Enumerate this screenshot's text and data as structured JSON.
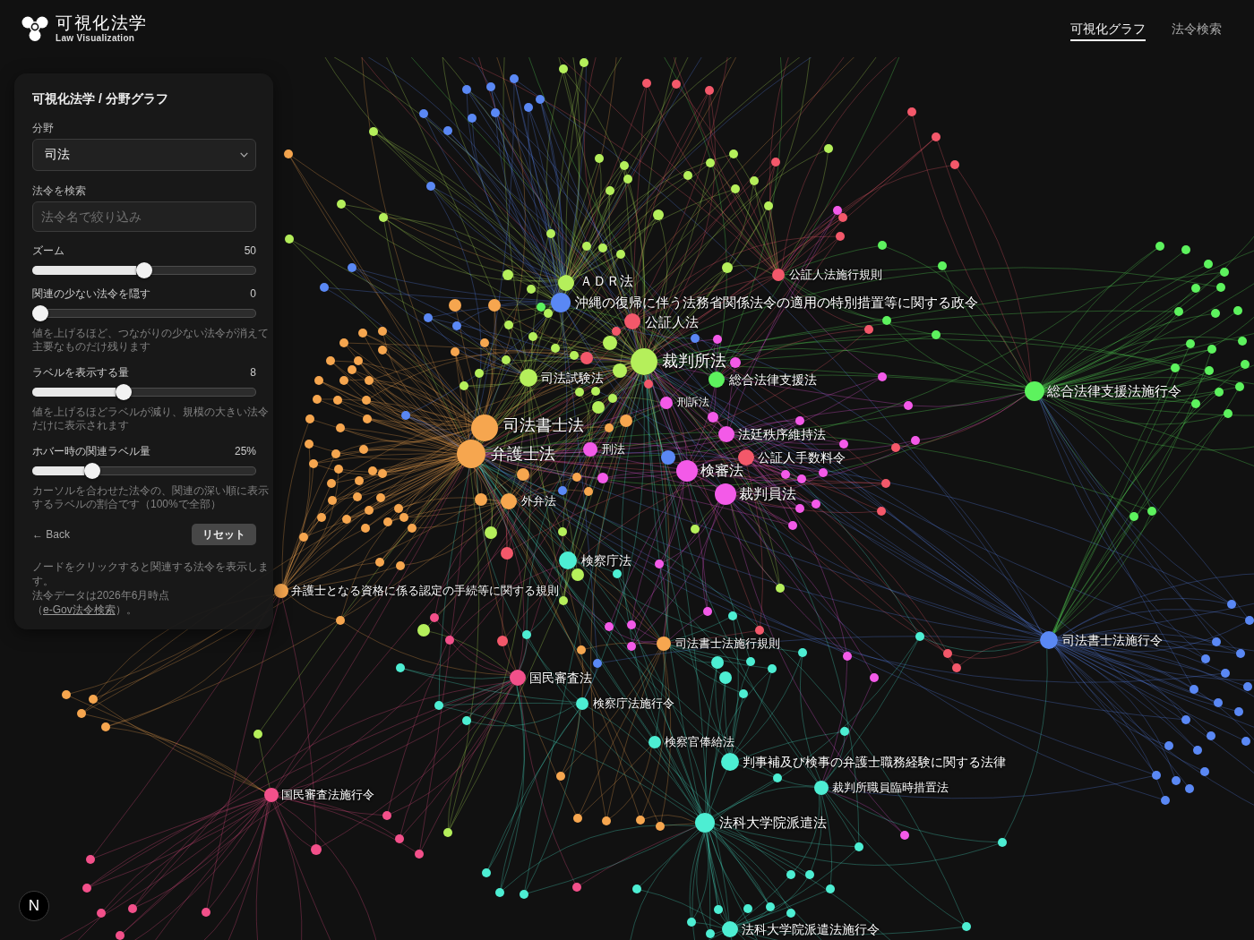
{
  "header": {
    "logo_title": "可視化法学",
    "logo_subtitle": "Law Visualization",
    "tabs": [
      {
        "label": "可視化グラフ",
        "selected": true
      },
      {
        "label": "法令検索",
        "selected": false
      }
    ]
  },
  "panel": {
    "title": "可視化法学 / 分野グラフ",
    "field_select": {
      "label": "分野",
      "value": "司法"
    },
    "search": {
      "label": "法令を検索",
      "placeholder": "法令名で絞り込み"
    },
    "sliders": [
      {
        "label": "ズーム",
        "value": "50",
        "level": 0.5
      },
      {
        "label": "関連の少ない法令を隠す",
        "value": "0",
        "level": 0,
        "help": "値を上げるほど、つながりの少ない法令が消えて主要なものだけ残ります"
      },
      {
        "label": "ラベルを表示する量",
        "value": "8",
        "level": 0.4,
        "help": "値を上げるほどラベルが減り、規模の大きい法令だけに表示されます"
      },
      {
        "label": "ホバー時の関連ラベル量",
        "value": "25%",
        "level": 0.25,
        "help": "カーソルを合わせた法令の、関連の深い順に表示するラベルの割合です（100%で全部）"
      }
    ],
    "back_link": "← Back",
    "reset_button": "リセット",
    "hint": "ノードをクリックすると関連する法令を表示します。",
    "source_note": {
      "before": "法令データは2026年6月時点（",
      "link": "e-Gov法令検索",
      "after": "）。"
    }
  },
  "graph": {
    "nodes": [
      {
        "label": "公証人法施行規則",
        "color": "#f3586a"
      },
      {
        "label": "ＡＤＲ法",
        "color": "#b5ef5b"
      },
      {
        "label": "沖縄の復帰に伴う法務省関係法令の適用の特別措置等に関する政令",
        "color": "#5a88f4"
      },
      {
        "label": "公証人法",
        "color": "#f3586a"
      },
      {
        "label": "裁判所法",
        "color": "#b5ef5b"
      },
      {
        "label": "司法試験法",
        "color": "#b5ef5b"
      },
      {
        "label": "総合法律支援法",
        "color": "#5df25e"
      },
      {
        "label": "総合法律支援法施行令",
        "color": "#5df25e"
      },
      {
        "label": "刑訴法",
        "color": "#f35ae8"
      },
      {
        "label": "法廷秩序維持法",
        "color": "#f35ae8"
      },
      {
        "label": "司法書士法",
        "color": "#f6a64f"
      },
      {
        "label": "弁護士法",
        "color": "#f6a64f"
      },
      {
        "label": "刑法",
        "color": "#f35ae8"
      },
      {
        "label": "公証人手数料令",
        "color": "#f3586a"
      },
      {
        "label": "検審法",
        "color": "#f35ae8"
      },
      {
        "label": "裁判員法",
        "color": "#f35ae8"
      },
      {
        "label": "外弁法",
        "color": "#f6a64f"
      },
      {
        "label": "検察庁法",
        "color": "#4deed3"
      },
      {
        "label": "弁護士となる資格に係る認定の手続等に関する規則",
        "color": "#f6a64f"
      },
      {
        "label": "司法書士法施行規則",
        "color": "#f6a64f"
      },
      {
        "label": "司法書士法施行令",
        "color": "#5a88f4"
      },
      {
        "label": "国民審査法",
        "color": "#f2508a"
      },
      {
        "label": "検察庁法施行令",
        "color": "#4deed3"
      },
      {
        "label": "検察官俸給法",
        "color": "#4deed3"
      },
      {
        "label": "判事補及び検事の弁護士職務経験に関する法律",
        "color": "#4deed3"
      },
      {
        "label": "裁判所職員臨時措置法",
        "color": "#4deed3"
      },
      {
        "label": "法科大学院派遣法",
        "color": "#4deed3"
      },
      {
        "label": "国民審査法施行令",
        "color": "#f2508a"
      },
      {
        "label": "法科大学院派遣法施行令",
        "color": "#4deed3"
      }
    ]
  },
  "dev_badge": "N"
}
